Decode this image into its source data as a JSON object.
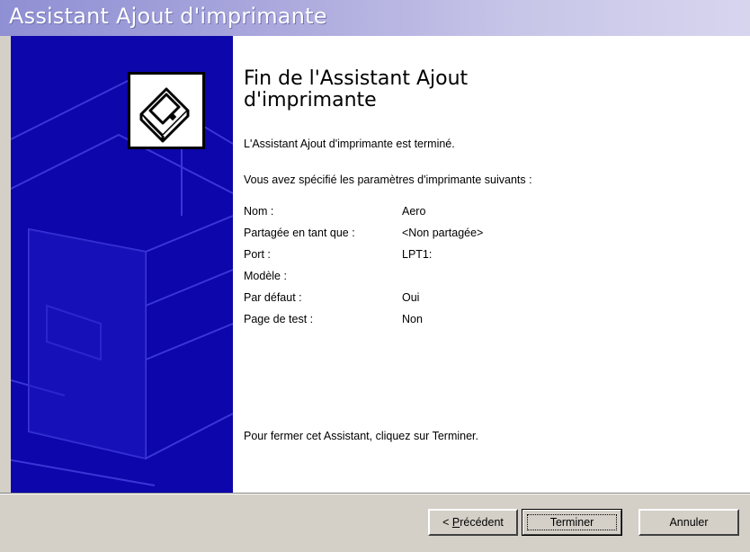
{
  "window": {
    "title": "Assistant Ajout d'imprimante"
  },
  "main": {
    "heading": "Fin de l'Assistant Ajout d'imprimante",
    "completed_text": "L'Assistant Ajout d'imprimante est terminé.",
    "specified_text": "Vous avez spécifié les paramètres d'imprimante suivants :",
    "settings": [
      {
        "label": "Nom :",
        "value": "Aero"
      },
      {
        "label": "Partagée en tant que :",
        "value": "<Non partagée>"
      },
      {
        "label": "Port :",
        "value": "LPT1:"
      },
      {
        "label": "Modèle :",
        "value": ""
      },
      {
        "label": "Par défaut :",
        "value": "Oui"
      },
      {
        "label": "Page de test :",
        "value": "Non"
      }
    ],
    "close_text": "Pour fermer cet Assistant, cliquez sur Terminer."
  },
  "buttons": {
    "back_prefix": "< ",
    "back_mnemonic": "P",
    "back_rest": "récédent",
    "finish_label": "Terminer",
    "cancel_label": "Annuler"
  },
  "icons": {
    "side_art": "printer-wireframe-art",
    "wizard": "printer-icon"
  },
  "colors": {
    "side_panel": "#0d06aa",
    "title_gradient_start": "#8f8fd4",
    "dialog_face": "#d4d0c8"
  }
}
